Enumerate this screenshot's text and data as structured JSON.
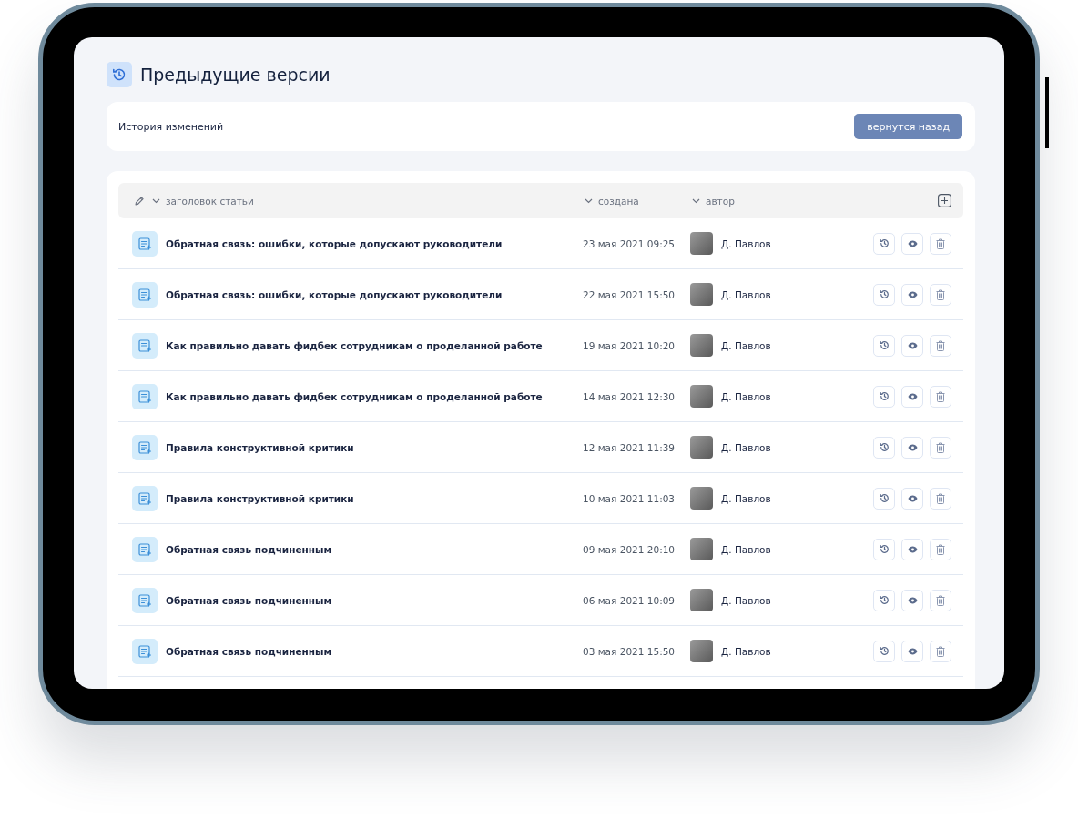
{
  "page": {
    "title": "Предыдущие версии"
  },
  "history_card": {
    "label": "История изменений",
    "back_button": "вернутся назад"
  },
  "table": {
    "columns": [
      {
        "label": "заголовок статьи"
      },
      {
        "label": "создана"
      },
      {
        "label": "автор"
      }
    ],
    "rows": [
      {
        "title": "Обратная связь: ошибки, которые допускают руководители",
        "created": "23 мая 2021 09:25",
        "author": "Д. Павлов"
      },
      {
        "title": "Обратная связь: ошибки, которые допускают руководители",
        "created": "22 мая 2021 15:50",
        "author": "Д. Павлов"
      },
      {
        "title": "Как правильно давать фидбек сотрудникам о проделанной работе",
        "created": "19 мая 2021 10:20",
        "author": "Д. Павлов"
      },
      {
        "title": "Как правильно давать фидбек сотрудникам о проделанной работе",
        "created": "14 мая 2021 12:30",
        "author": "Д. Павлов"
      },
      {
        "title": "Правила конструктивной критики",
        "created": "12 мая 2021 11:39",
        "author": "Д. Павлов"
      },
      {
        "title": "Правила конструктивной критики",
        "created": "10 мая 2021 11:03",
        "author": "Д. Павлов"
      },
      {
        "title": "Обратная связь подчиненным",
        "created": "09 мая 2021 20:10",
        "author": "Д. Павлов"
      },
      {
        "title": "Обратная связь подчиненным",
        "created": "06 мая 2021 10:09",
        "author": "Д. Павлов"
      },
      {
        "title": "Обратная связь подчиненным",
        "created": "03 мая 2021 15:50",
        "author": "Д. Павлов"
      }
    ]
  }
}
